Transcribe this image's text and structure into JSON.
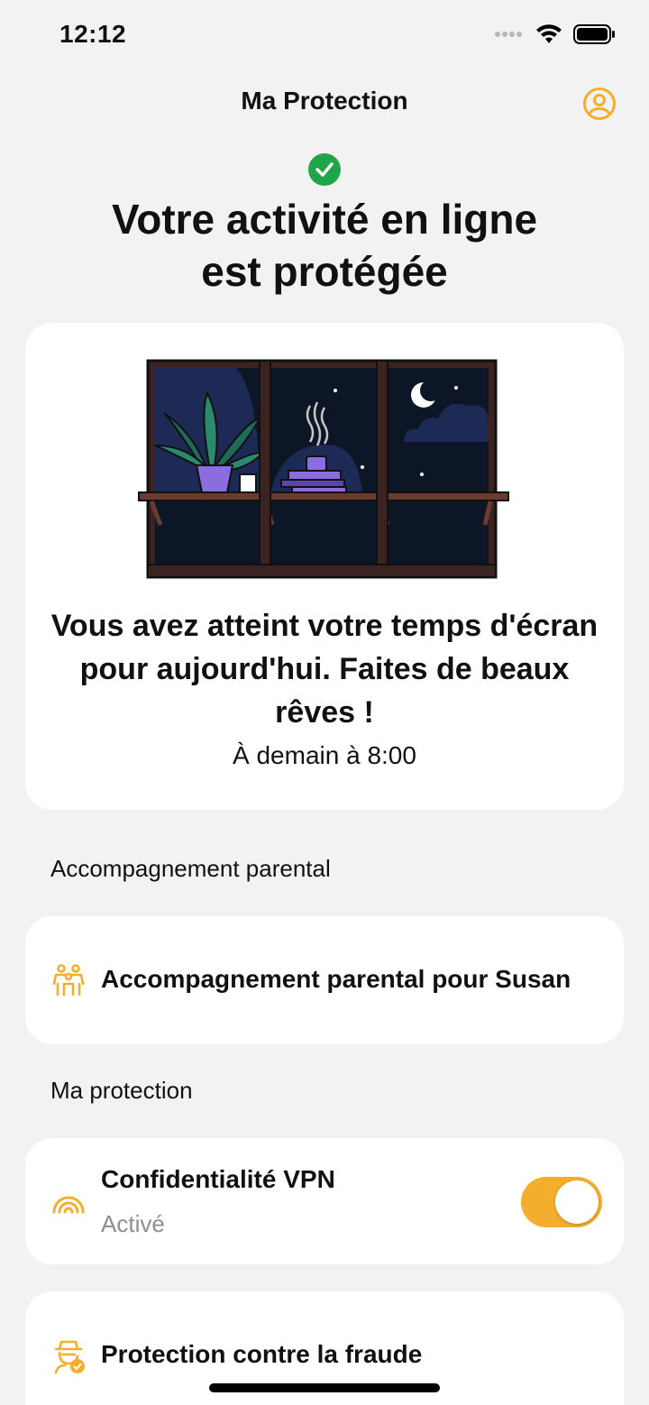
{
  "status_bar": {
    "time": "12:12",
    "icons": [
      "signal-dots-icon",
      "wifi-icon",
      "battery-icon"
    ]
  },
  "header": {
    "title": "Ma Protection",
    "profile_icon": "user-circle-icon"
  },
  "hero": {
    "status_icon": "check-circle-icon",
    "title_line1": "Votre activité en ligne",
    "title_line2": "est protégée"
  },
  "screen_time_card": {
    "illustration": "night-window-shelf-illustration",
    "message": "Vous avez atteint votre temps d'écran pour aujourd'hui. Faites de beaux rêves !",
    "subtitle": "À demain à 8:00"
  },
  "parental_section": {
    "label": "Accompagnement parental",
    "items": [
      {
        "icon": "family-icon",
        "label": "Accompagnement parental pour Susan"
      }
    ]
  },
  "protection_section": {
    "label": "Ma protection",
    "vpn": {
      "icon": "vpn-signal-icon",
      "title": "Confidentialité VPN",
      "status": "Activé",
      "enabled": true
    },
    "fraud": {
      "icon": "fraud-agent-icon",
      "title": "Protection contre la fraude"
    }
  },
  "colors": {
    "accent": "#f3ae2e",
    "success": "#1fa54a",
    "background": "#f2f2f2",
    "card": "#ffffff",
    "secondary_text": "#8e8e93"
  }
}
